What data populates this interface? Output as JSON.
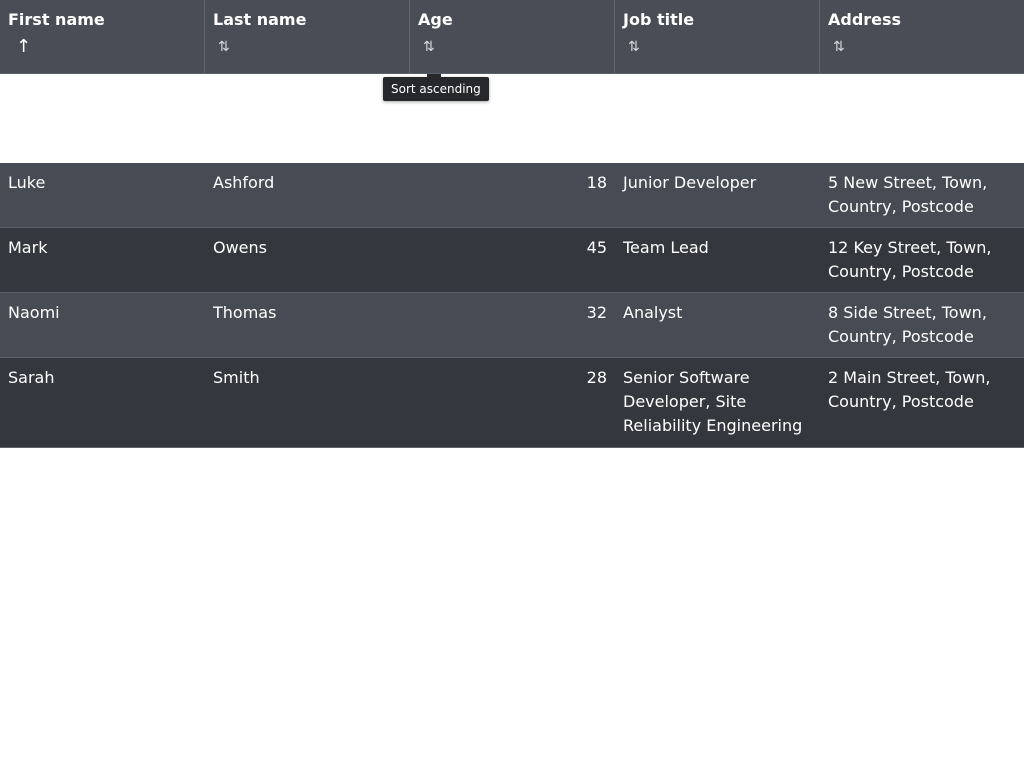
{
  "table": {
    "columns": [
      {
        "label": "First name",
        "sort_icon": "↑",
        "sort_state": "ascending"
      },
      {
        "label": "Last name",
        "sort_icon": "⇅",
        "sort_state": "none"
      },
      {
        "label": "Age",
        "sort_icon": "⇅",
        "sort_state": "none"
      },
      {
        "label": "Job title",
        "sort_icon": "⇅",
        "sort_state": "none"
      },
      {
        "label": "Address",
        "sort_icon": "⇅",
        "sort_state": "none"
      }
    ],
    "tooltip": "Sort ascending",
    "rows": [
      {
        "first": "Luke",
        "last": "Ashford",
        "age": "18",
        "job": "Junior Developer",
        "address": "5 New Street, Town, Country, Postcode"
      },
      {
        "first": "Mark",
        "last": "Owens",
        "age": "45",
        "job": "Team Lead",
        "address": "12 Key Street, Town, Country, Postcode"
      },
      {
        "first": "Naomi",
        "last": "Thomas",
        "age": "32",
        "job": "Analyst",
        "address": "8 Side Street, Town, Country, Postcode"
      },
      {
        "first": "Sarah",
        "last": "Smith",
        "age": "28",
        "job": "Senior Software Developer, Site Reliability Engineering",
        "address": "2 Main Street, Town, Country, Postcode"
      }
    ]
  },
  "colors": {
    "header_bg": "#494d55",
    "row_odd_bg": "#474b53",
    "row_even_bg": "#34373d",
    "tooltip_bg": "#26282b"
  }
}
